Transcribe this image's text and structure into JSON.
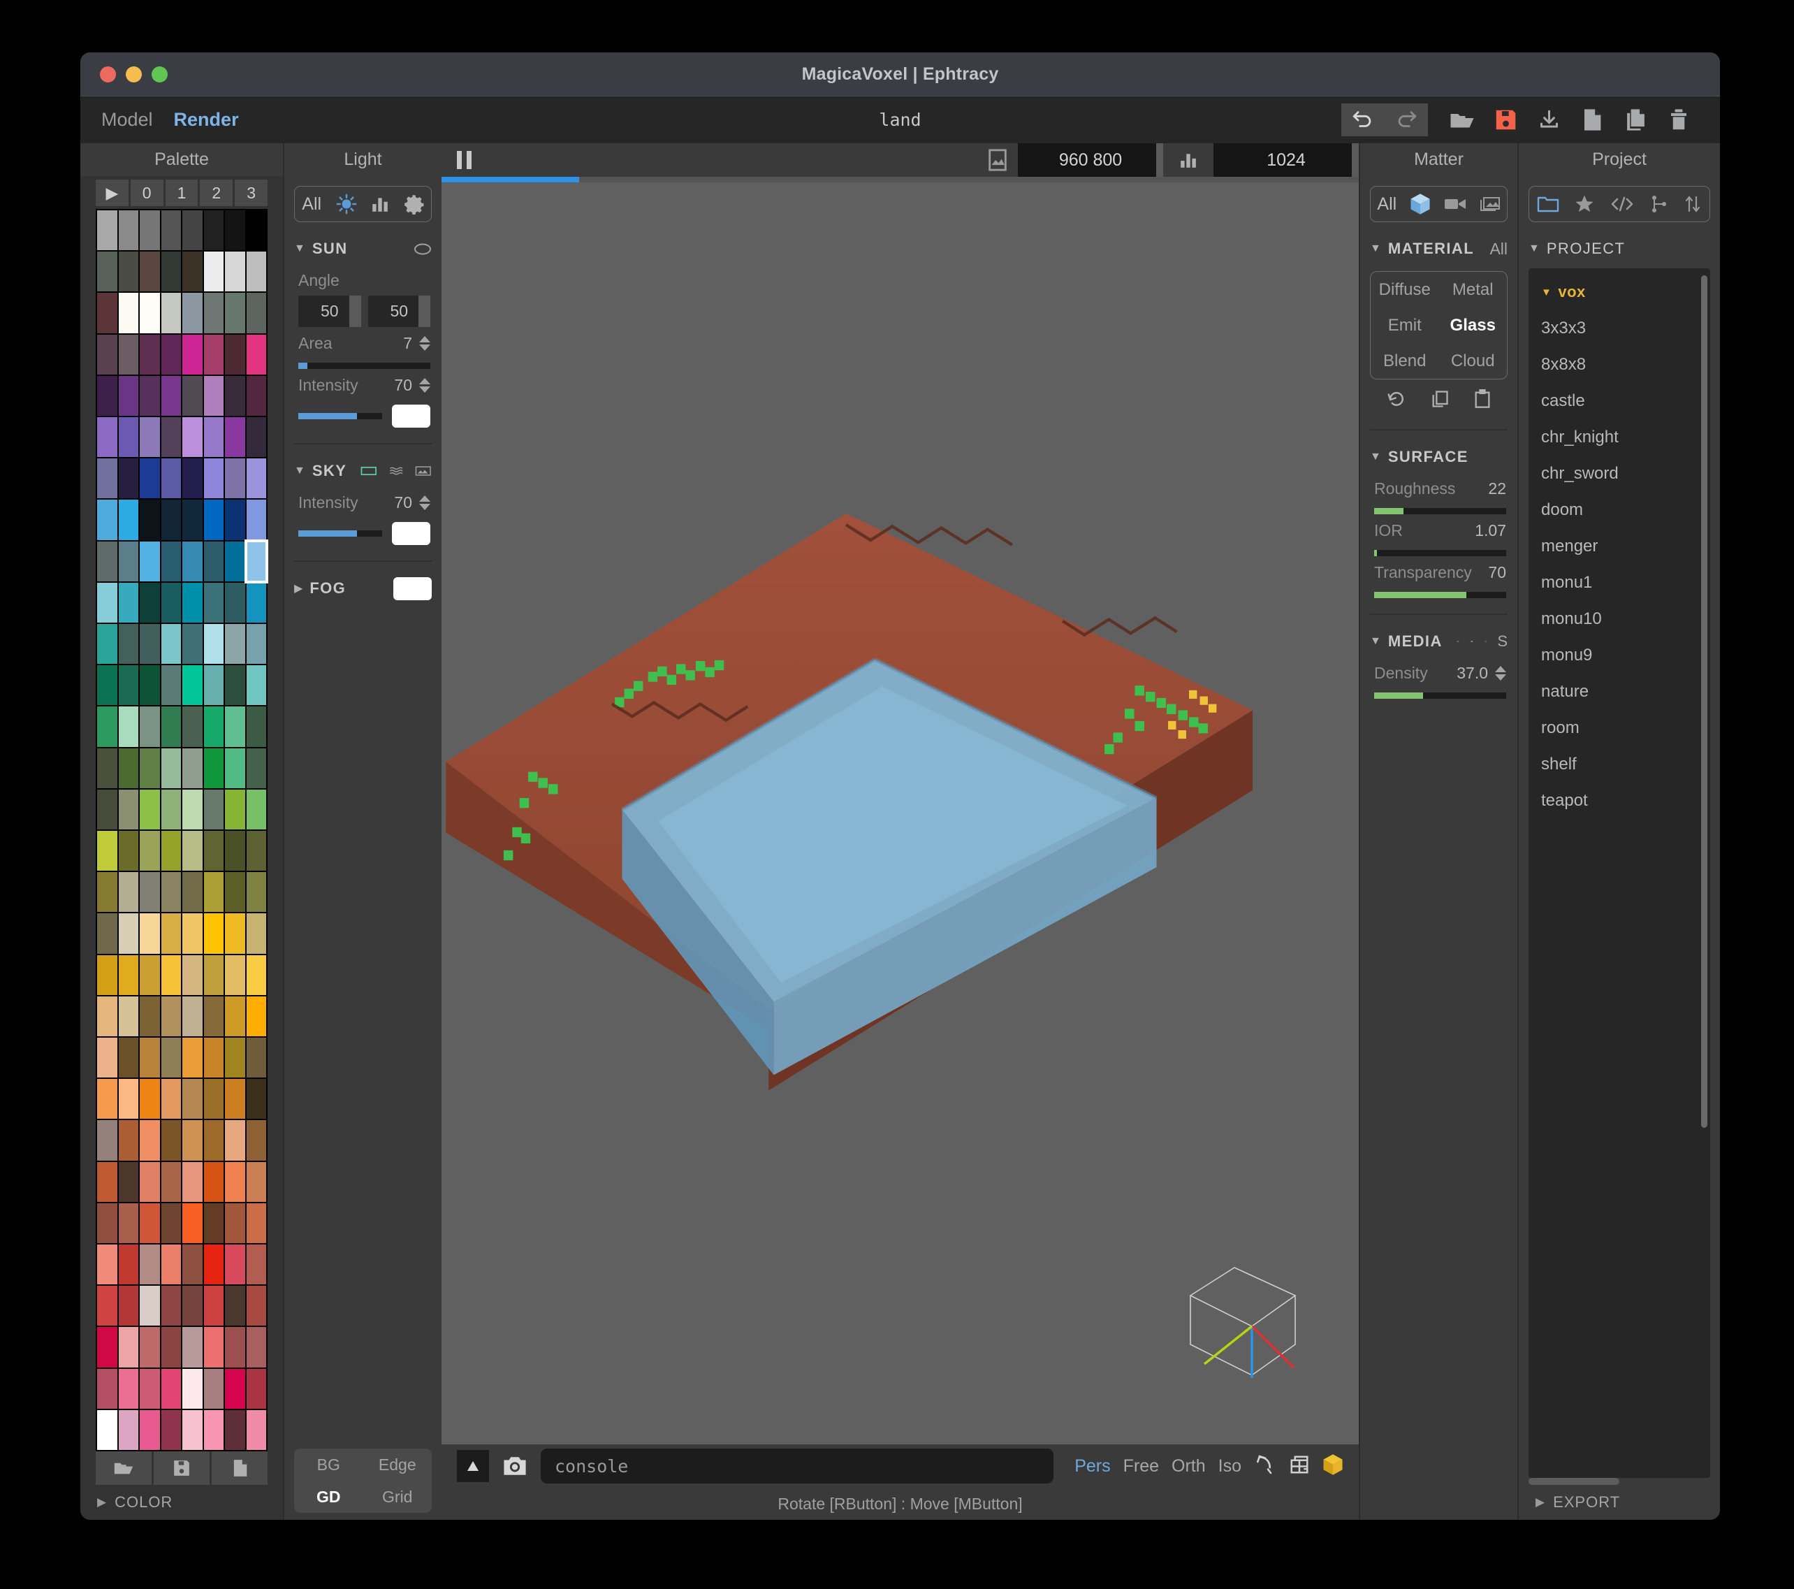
{
  "window": {
    "title": "MagicaVoxel | Ephtracy",
    "traffic": [
      "close",
      "minimize",
      "maximize"
    ]
  },
  "menubar": {
    "items": [
      {
        "label": "Model",
        "active": false
      },
      {
        "label": "Render",
        "active": true
      }
    ],
    "model_name": "land",
    "toolbar": [
      {
        "name": "undo-icon",
        "label": "Undo",
        "boxed": true,
        "dim": false
      },
      {
        "name": "redo-icon",
        "label": "Redo",
        "boxed": true,
        "dim": true
      },
      {
        "name": "open-folder-icon",
        "label": "Open",
        "boxed": false,
        "dim": false
      },
      {
        "name": "save-icon",
        "label": "Save",
        "boxed": false,
        "dim": false,
        "color": "#f4624a"
      },
      {
        "name": "download-icon",
        "label": "Download",
        "boxed": false,
        "dim": false
      },
      {
        "name": "new-file-icon",
        "label": "New",
        "boxed": false,
        "dim": false
      },
      {
        "name": "copy-icon",
        "label": "Copy",
        "boxed": false,
        "dim": false
      },
      {
        "name": "trash-icon",
        "label": "Delete",
        "boxed": false,
        "dim": false
      }
    ]
  },
  "palette": {
    "title": "Palette",
    "tabs": [
      "▶",
      "0",
      "1",
      "2",
      "3"
    ],
    "selected_index": 71,
    "file_buttons": [
      "open-palette",
      "save-palette",
      "new-palette"
    ],
    "color_section": {
      "label": "COLOR",
      "expanded": false
    },
    "colors": [
      "#a8a8a8",
      "#8a8a8a",
      "#767676",
      "#555555",
      "#444444",
      "#212121",
      "#141414",
      "#000000",
      "#58605a",
      "#4a4b42",
      "#5a4740",
      "#333a36",
      "#3b3326",
      "#ececec",
      "#d7d7d7",
      "#bdbdbd",
      "#5c3539",
      "#fdfaf3",
      "#fffdf8",
      "#c4c8c1",
      "#8b98a2",
      "#6e7773",
      "#66776e",
      "#5e6560",
      "#59414f",
      "#6e5c64",
      "#5f2f52",
      "#62275a",
      "#cc2593",
      "#a63e6c",
      "#4d2a33",
      "#e3357f",
      "#3e1f4b",
      "#6a3584",
      "#58305e",
      "#79368d",
      "#514a55",
      "#b07dbd",
      "#3a2b3c",
      "#53273f",
      "#8b6ac4",
      "#6c5ab2",
      "#8d79b7",
      "#534059",
      "#bb8fdb",
      "#9779cc",
      "#88389e",
      "#35293c",
      "#6f709c",
      "#271f40",
      "#1c3b96",
      "#5a5aa5",
      "#241e4f",
      "#8d86dc",
      "#7e73a8",
      "#9b93dc",
      "#4eabde",
      "#2cabe2",
      "#0d1419",
      "#102637",
      "#10283a",
      "#0168c2",
      "#0b3272",
      "#7f98e0",
      "#5d6b6b",
      "#5b7f8a",
      "#52b2e3",
      "#2a5d70",
      "#368ab2",
      "#2b5d6b",
      "#016f9a",
      "#90c3e9",
      "#86cdd9",
      "#36a9bc",
      "#0d4038",
      "#1a5d61",
      "#008fa8",
      "#3b7178",
      "#2c5d63",
      "#1294bf",
      "#2aa39a",
      "#44605a",
      "#415f5c",
      "#7ac6c8",
      "#3e7076",
      "#afdfe8",
      "#8ca6a7",
      "#76a2ad",
      "#0b7253",
      "#1b6b53",
      "#0d5338",
      "#5a7b77",
      "#00c69a",
      "#68b0ae",
      "#2b4e3e",
      "#6fc5bf",
      "#2c9a5f",
      "#a9dbbf",
      "#7b9384",
      "#317c51",
      "#4b6050",
      "#17a96a",
      "#5fbf91",
      "#3d5a45",
      "#49513c",
      "#4a6b2f",
      "#5e8046",
      "#95bb9c",
      "#909e90",
      "#10973e",
      "#51bb86",
      "#43614b",
      "#474c3a",
      "#8b9070",
      "#8cbf45",
      "#8fb27b",
      "#bddaae",
      "#677a6a",
      "#86b434",
      "#76c165",
      "#c0cb3a",
      "#6b6b2a",
      "#9ba35b",
      "#95a128",
      "#b7bd86",
      "#5e6530",
      "#4a5126",
      "#5b6130",
      "#867a31",
      "#b3ae92",
      "#827f74",
      "#8a8362",
      "#716b48",
      "#aca034",
      "#5d5f27",
      "#7f8240",
      "#6f6849",
      "#d7ceb6",
      "#f5d697",
      "#d8ae44",
      "#f0c664",
      "#ffc400",
      "#efbb23",
      "#c6b371",
      "#d39f15",
      "#e1ab1f",
      "#cb9f31",
      "#f7c138",
      "#d3b680",
      "#bfa03a",
      "#e3bd64",
      "#f7cb42",
      "#e5b57e",
      "#d5c196",
      "#7c6336",
      "#b2925c",
      "#c0b092",
      "#866b38",
      "#cc9a25",
      "#ffae00",
      "#ecb38b",
      "#6c5027",
      "#b8823a",
      "#8f7d56",
      "#ea9c37",
      "#c9842a",
      "#a0841f",
      "#6e5c3a",
      "#f69b4d",
      "#fdb985",
      "#ee8413",
      "#e39862",
      "#b58752",
      "#9a6f28",
      "#cb7f20",
      "#3c301b",
      "#95817b",
      "#ab5e34",
      "#ef8f63",
      "#7c5526",
      "#cf9253",
      "#9e6a29",
      "#e8a87f",
      "#8d6133",
      "#bf5a32",
      "#4e372c",
      "#df8065",
      "#a86547",
      "#e6967d",
      "#d65316",
      "#ef8150",
      "#cb7f54",
      "#8f4e3e",
      "#a85f4c",
      "#cf5737",
      "#6e4531",
      "#f95e22",
      "#643c26",
      "#a0573a",
      "#cc6d4a",
      "#f08b79",
      "#c0392e",
      "#b28a86",
      "#ec7f69",
      "#8d5040",
      "#e72410",
      "#d9495c",
      "#b35c51",
      "#cf4343",
      "#b23737",
      "#d7cdc6",
      "#8d4442",
      "#75433b",
      "#cd4141",
      "#4a382f",
      "#a84a42",
      "#d00944",
      "#eda4a4",
      "#bf6a6a",
      "#8a4442",
      "#b79a9a",
      "#ec7070",
      "#9b4f4e",
      "#a85f5f",
      "#b24f63",
      "#ea6f90",
      "#ce5b73",
      "#e14372",
      "#fde8ec",
      "#a87f7f",
      "#d4044f",
      "#a83541",
      "#ffffff",
      "#dba6c4",
      "#e85b92",
      "#8f3351",
      "#f8c1d0",
      "#f895b5",
      "#5e2e39",
      "#f08aab"
    ]
  },
  "light": {
    "title": "Light",
    "segment": [
      {
        "name": "all-label",
        "label": "All"
      },
      {
        "name": "sun-icon",
        "label": ""
      },
      {
        "name": "histogram-icon",
        "label": ""
      },
      {
        "name": "gear-icon",
        "label": ""
      }
    ],
    "sun": {
      "label": "SUN",
      "expanded": true,
      "angle_label": "Angle",
      "angle_values": [
        "50",
        "50"
      ],
      "area_label": "Area",
      "area_value": "7",
      "area_fill_pct": 7,
      "intensity_label": "Intensity",
      "intensity_value": "70",
      "intensity_fill_pct": 70,
      "color_chip": "#ffffff"
    },
    "sky": {
      "label": "SKY",
      "expanded": true,
      "intensity_label": "Intensity",
      "intensity_value": "70",
      "intensity_fill_pct": 70,
      "color_chip": "#ffffff",
      "icons": [
        "sky-solid-icon",
        "sky-gradient-icon",
        "sky-image-icon"
      ]
    },
    "fog": {
      "label": "FOG",
      "expanded": false,
      "color_chip": "#ffffff"
    },
    "bg_edge": [
      {
        "label": "BG",
        "on": false
      },
      {
        "label": "Edge",
        "on": false
      },
      {
        "label": "GD",
        "on": true
      },
      {
        "label": "Grid",
        "on": false
      }
    ]
  },
  "render_bar": {
    "pause_label": "pause",
    "image_icon": "image-icon",
    "width_height": "960  800",
    "samples_icon": "samples-icon",
    "samples": "1024",
    "progress_pct": 15
  },
  "status": {
    "expand_icon": "expand-up-icon",
    "camera_icon": "camera-icon",
    "console_value": "console",
    "projection_modes": [
      {
        "label": "Pers",
        "on": true
      },
      {
        "label": "Free",
        "on": false
      },
      {
        "label": "Orth",
        "on": false
      },
      {
        "label": "Iso",
        "on": false
      }
    ],
    "view_icons": [
      "rotate-icon",
      "frame-icon",
      "box-icon"
    ],
    "hint": "Rotate [RButton] : Move [MButton]"
  },
  "matter": {
    "title": "Matter",
    "segment": [
      {
        "name": "all-label",
        "label": "All"
      },
      {
        "name": "cube-icon",
        "label": ""
      },
      {
        "name": "video-icon",
        "label": ""
      },
      {
        "name": "image-stack-icon",
        "label": ""
      }
    ],
    "material": {
      "label": "MATERIAL",
      "all_label": "All",
      "expanded": true,
      "types": [
        {
          "label": "Diffuse",
          "on": false
        },
        {
          "label": "Metal",
          "on": false
        },
        {
          "label": "Emit",
          "on": false
        },
        {
          "label": "Glass",
          "on": true
        },
        {
          "label": "Blend",
          "on": false
        },
        {
          "label": "Cloud",
          "on": false
        }
      ],
      "actions": [
        "reset-icon",
        "copy-icon",
        "paste-icon"
      ]
    },
    "surface": {
      "label": "SURFACE",
      "expanded": true,
      "rows": [
        {
          "label": "Roughness",
          "value": "22",
          "fill_pct": 22
        },
        {
          "label": "IOR",
          "value": "1.07",
          "fill_pct": 2
        },
        {
          "label": "Transparency",
          "value": "70",
          "fill_pct": 70
        }
      ]
    },
    "media": {
      "label": "MEDIA",
      "expanded": true,
      "icons": [
        "absorb-icon",
        "cloud-icon",
        "sun-icon"
      ],
      "s_label": "S",
      "density_label": "Density",
      "density_value": "37.0",
      "density_fill_pct": 37
    }
  },
  "project": {
    "title": "Project",
    "segment": [
      {
        "name": "folder-icon",
        "label": ""
      },
      {
        "name": "star-icon",
        "label": ""
      },
      {
        "name": "code-icon",
        "label": ""
      },
      {
        "name": "node-graph-icon",
        "label": ""
      },
      {
        "name": "sort-icon",
        "label": ""
      }
    ],
    "section_label": "PROJECT",
    "group_label": "vox",
    "items": [
      "3x3x3",
      "8x8x8",
      "castle",
      "chr_knight",
      "chr_sword",
      "doom",
      "menger",
      "monu1",
      "monu10",
      "monu9",
      "nature",
      "room",
      "shelf",
      "teapot"
    ],
    "export_label": "EXPORT"
  },
  "colors": {
    "accent_blue": "#6fa8dc",
    "accent_green": "#82c46f",
    "accent_yellow": "#e8b33a",
    "save_red": "#f4624a",
    "viewport_bg": "#606060"
  }
}
